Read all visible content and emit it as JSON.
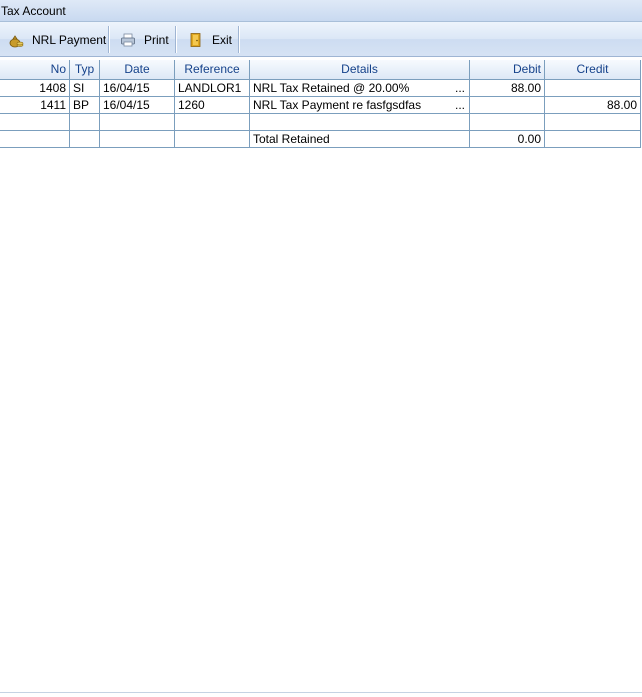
{
  "window": {
    "title": "Tax Account"
  },
  "toolbar": {
    "nrl_payment_label": "NRL Payment",
    "print_label": "Print",
    "exit_label": "Exit"
  },
  "table": {
    "headers": [
      "No",
      "Typ",
      "Date",
      "Reference",
      "Details",
      "Debit",
      "Credit"
    ],
    "rows": [
      {
        "no": "1408",
        "typ": "SI",
        "date": "16/04/15",
        "reference": "LANDLOR1",
        "details": "NRL Tax Retained @ 20.00%",
        "ellipsis": "...",
        "debit": "88.00",
        "credit": ""
      },
      {
        "no": "1411",
        "typ": "BP",
        "date": "16/04/15",
        "reference": "1260",
        "details": "NRL Tax Payment re fasfgsdfas",
        "ellipsis": "...",
        "debit": "",
        "credit": "88.00"
      }
    ],
    "total": {
      "label": "Total Retained",
      "debit": "0.00"
    }
  }
}
